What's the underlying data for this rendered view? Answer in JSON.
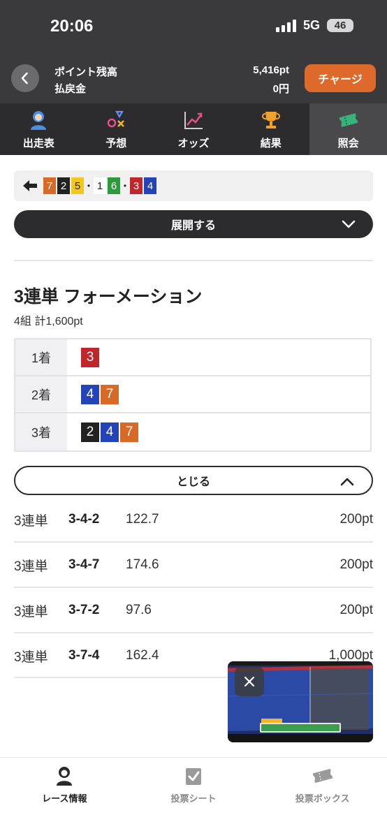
{
  "status": {
    "time": "20:06",
    "network": "5G",
    "battery": "46"
  },
  "header": {
    "points_label": "ポイント残高",
    "points_value": "5,416pt",
    "refund_label": "払戻金",
    "refund_value": "0円",
    "charge_button": "チャージ"
  },
  "tabs": [
    {
      "label": "出走表",
      "icon": "racer-icon"
    },
    {
      "label": "予想",
      "icon": "prediction-icon"
    },
    {
      "label": "オッズ",
      "icon": "odds-chart-icon"
    },
    {
      "label": "結果",
      "icon": "trophy-icon"
    },
    {
      "label": "照会",
      "icon": "ticket-icon",
      "active": true
    }
  ],
  "route": {
    "icon": "arrow-left-icon",
    "sequence": [
      "7",
      "2",
      "5",
      "•",
      "1",
      "6",
      "•",
      "3",
      "4"
    ]
  },
  "expand_button": "展開する",
  "bet": {
    "title": "3連単 フォーメーション",
    "summary": "4組 計1,600pt",
    "formation": [
      {
        "place": "1着",
        "numbers": [
          "3"
        ]
      },
      {
        "place": "2着",
        "numbers": [
          "4",
          "7"
        ]
      },
      {
        "place": "3着",
        "numbers": [
          "2",
          "4",
          "7"
        ]
      }
    ]
  },
  "close_button": "とじる",
  "bets": [
    {
      "type": "3連単",
      "combo": "3-4-2",
      "odds": "122.7",
      "amount": "200pt"
    },
    {
      "type": "3連単",
      "combo": "3-4-7",
      "odds": "174.6",
      "amount": "200pt"
    },
    {
      "type": "3連単",
      "combo": "3-7-2",
      "odds": "97.6",
      "amount": "200pt"
    },
    {
      "type": "3連単",
      "combo": "3-7-4",
      "odds": "162.4",
      "amount": "1,000pt"
    }
  ],
  "video": {
    "close_icon": "close-icon"
  },
  "bottom_nav": [
    {
      "label": "レース情報",
      "icon": "racer-info-icon",
      "active": true
    },
    {
      "label": "投票シート",
      "icon": "vote-sheet-icon"
    },
    {
      "label": "投票ボックス",
      "icon": "vote-box-icon"
    }
  ],
  "colors": {
    "header_bg": "#3a3a3c",
    "tab_bg": "#2c2c2e",
    "accent": "#dd6a2a",
    "boat_1": "#ffffff",
    "boat_2": "#222222",
    "boat_3": "#c0262a",
    "boat_4": "#2344b8",
    "boat_5": "#f2c81e",
    "boat_6": "#2c9b3c",
    "boat_7": "#d86a28"
  }
}
